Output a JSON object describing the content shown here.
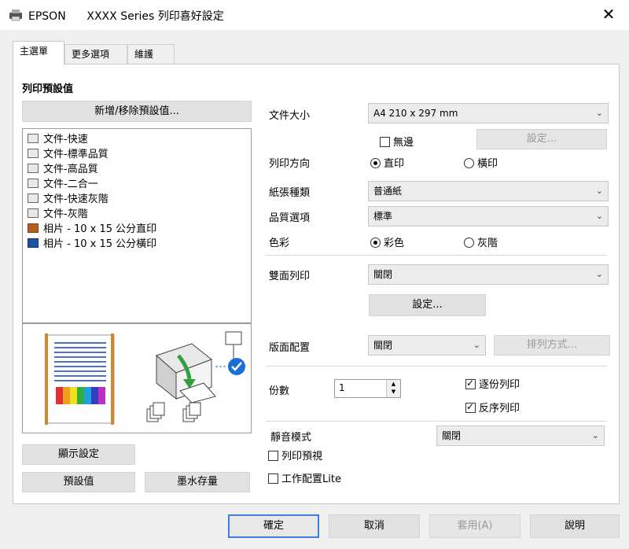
{
  "window": {
    "brand": "EPSON",
    "title": "XXXX Series 列印喜好設定",
    "close_glyph": "✕"
  },
  "tabs": [
    "主選單",
    "更多選項",
    "維護"
  ],
  "presets": {
    "section_title": "列印預設值",
    "add_remove_label": "新增/移除預設值...",
    "items": [
      "文件-快速",
      "文件-標準品質",
      "文件-高品質",
      "文件-二合一",
      "文件-快速灰階",
      "文件-灰階",
      "相片 - 10 x 15 公分直印",
      "相片 - 10 x 15 公分橫印"
    ]
  },
  "settings": {
    "paper_size_label": "文件大小",
    "paper_size_value": "A4 210 x 297 mm",
    "borderless_label": "無邊",
    "borderless_checked": false,
    "settings_btn_label": "設定...",
    "orientation_label": "列印方向",
    "portrait_label": "直印",
    "landscape_label": "橫印",
    "paper_type_label": "紙張種類",
    "paper_type_value": "普通紙",
    "quality_label": "品質選項",
    "quality_value": "標準",
    "color_label": "色彩",
    "color_option_label": "彩色",
    "grayscale_label": "灰階",
    "duplex_label": "雙面列印",
    "duplex_value": "關閉",
    "duplex_settings_label": "設定...",
    "layout_label": "版面配置",
    "layout_value": "關閉",
    "order_label": "排列方式...",
    "copies_label": "份數",
    "copies_value": "1",
    "collate_label": "逐份列印",
    "collate_checked": true,
    "reverse_label": "反序列印",
    "reverse_checked": true,
    "quiet_label": "靜音模式",
    "quiet_value": "關閉",
    "print_preview_label": "列印預視",
    "job_arranger_label": "工作配置Lite"
  },
  "left_buttons": {
    "show_settings": "顯示設定",
    "defaults": "預設值",
    "ink_levels": "墨水存量"
  },
  "footer": {
    "ok": "確定",
    "cancel": "取消",
    "apply": "套用(A)",
    "help": "說明"
  },
  "colors": {
    "accent": "#3f7fd8",
    "check_badge": "#1a6fd6"
  }
}
